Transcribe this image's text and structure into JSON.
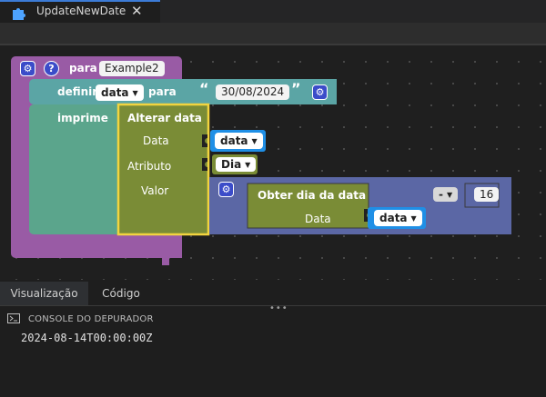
{
  "tab": {
    "title": "UpdateNewDate",
    "close": "✕",
    "icon": "puzzle-icon"
  },
  "blocks": {
    "procedure": {
      "keyword": "para",
      "name": "Example2",
      "color": "#995ba5"
    },
    "set": {
      "keyword": "definir",
      "variable": "data",
      "connector": "para",
      "color": "#5ba5a5"
    },
    "string": {
      "open_quote": "“",
      "value": "30/08/2024",
      "close_quote": "”"
    },
    "print": {
      "keyword": "imprime"
    },
    "change": {
      "title": "Alterar data",
      "color": "#7a8c36",
      "highlight": "#f2d43f"
    },
    "inputs": {
      "data_label": "Data",
      "attr_label": "Atributo",
      "value_label": "Valor"
    },
    "data_var": "data",
    "attribute": "Dia",
    "math": {
      "operator": "-",
      "number": "16",
      "color": "#5b67a5"
    },
    "get_day": {
      "title": "Obter dia da data",
      "input_label": "Data",
      "variable": "data"
    }
  },
  "panel": {
    "tabs": [
      {
        "label": "Visualização",
        "active": true
      },
      {
        "label": "Código",
        "active": false
      }
    ],
    "resize_handle": "•••",
    "console": {
      "title": "CONSOLE DO DEPURADOR",
      "output": "2024-08-14T00:00:00Z"
    }
  },
  "colors": {
    "variable_block": "#1f8fe6",
    "gear": "#3b4cc9"
  }
}
